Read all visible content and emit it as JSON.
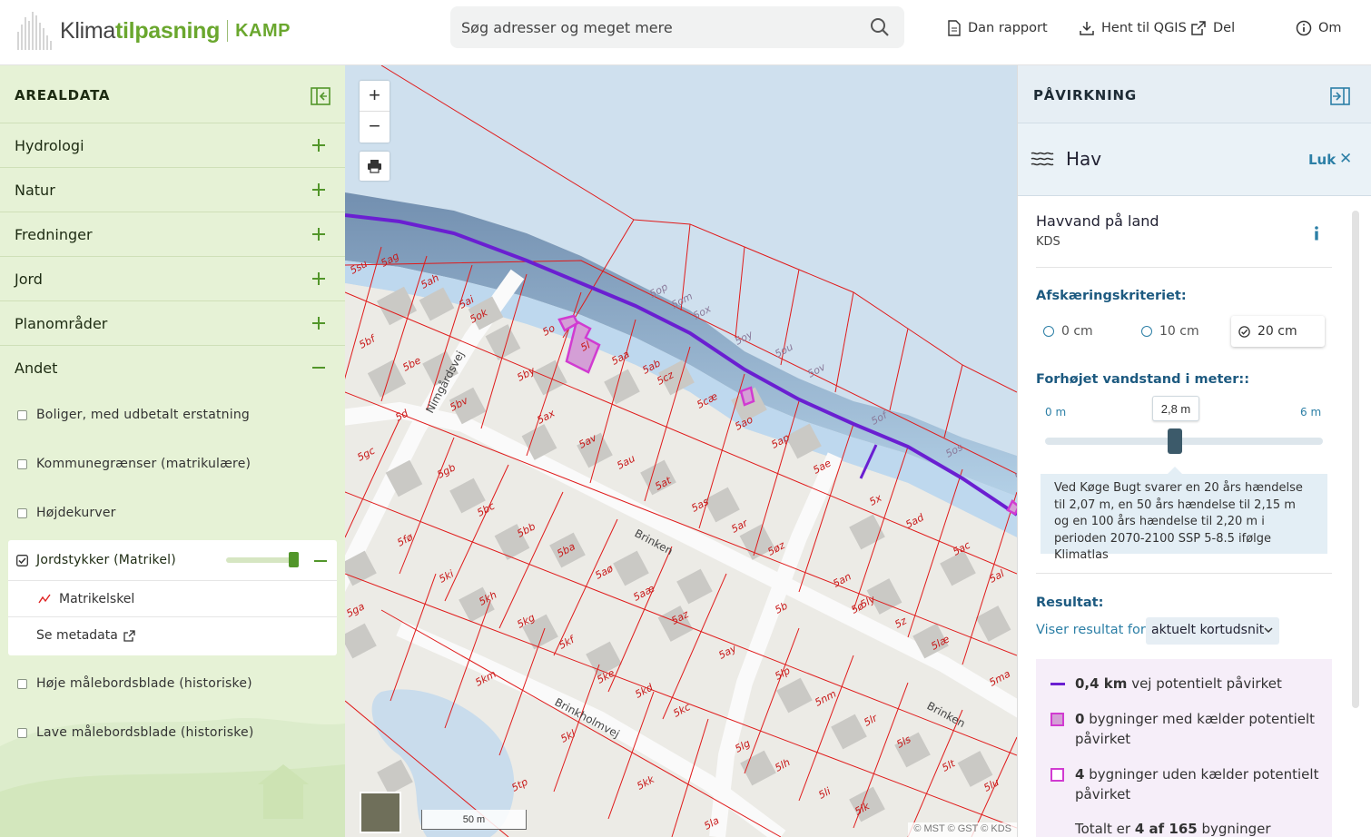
{
  "header": {
    "logo_word1": "Klima",
    "logo_word2": "tilpasning",
    "logo_kamp": "KAMP",
    "search_placeholder": "Søg adresser og meget mere",
    "buttons": [
      {
        "label": "Dan rapport",
        "icon": "document-icon"
      },
      {
        "label": "Hent til QGIS",
        "icon": "download-icon"
      },
      {
        "label": "Del",
        "icon": "share-icon"
      },
      {
        "label": "Om",
        "icon": "info-icon"
      }
    ]
  },
  "left_panel": {
    "title": "AREALDATA",
    "categories": [
      "Hydrologi",
      "Natur",
      "Fredninger",
      "Jord",
      "Planområder",
      "Andet"
    ],
    "layers": [
      "Boliger, med udbetalt erstatning",
      "Kommunegrænser (matrikulære)",
      "Højdekurver"
    ],
    "active_layer": {
      "label": "Jordstykker (Matrikel)",
      "opacity_fraction": 0.9,
      "legend_item": "Matrikelskel",
      "metadata_link": "Se metadata"
    },
    "layers_after": [
      "Høje målebordsblade (historiske)",
      "Lave målebordsblade (historiske)"
    ]
  },
  "map": {
    "zoom_in": "+",
    "zoom_out": "−",
    "scale_label": "50 m",
    "attribution": "© MST  © GST  © KDS",
    "road_labels": [
      "Nimgårdsvej",
      "Brinken",
      "Brinkholmvej",
      "Brinken"
    ],
    "parcel_labels": [
      "5su",
      "5ag",
      "5ah",
      "5ai",
      "5ok",
      "5bf",
      "5be",
      "5o",
      "5l",
      "5by",
      "5aa",
      "5ab",
      "5cz",
      "5bv",
      "5d",
      "5ax",
      "5av",
      "5cæ",
      "5ao",
      "5ap",
      "5ae",
      "5gc",
      "5gb",
      "5bc",
      "5au",
      "5at",
      "5as",
      "5ar",
      "5x",
      "5ad",
      "5ac",
      "5fø",
      "5bb",
      "5ba",
      "5øz",
      "5an",
      "5ly",
      "5z",
      "5al",
      "5ki",
      "5kh",
      "5aø",
      "5aæ",
      "5az",
      "5ay",
      "5b",
      "5ø",
      "5læ",
      "5ga",
      "5kg",
      "5kf",
      "5ke",
      "5kd",
      "5kc",
      "5lp",
      "5nm",
      "5ma",
      "5km",
      "5kl",
      "5lg",
      "5lr",
      "5ls",
      "5lh",
      "5li",
      "5lt",
      "5lu",
      "5tp",
      "5kk",
      "5lk",
      "5la",
      "5op",
      "5om",
      "5ox",
      "5oy",
      "5ou",
      "5ov",
      "5of",
      "5os",
      "5or"
    ]
  },
  "right_panel": {
    "title": "PÅVIRKNING",
    "section": "Hav",
    "close_label": "Luk",
    "layer_title": "Havvand på land",
    "layer_source": "KDS",
    "criteria_label": "Afskæringskriteriet:",
    "criteria_options": [
      "0 cm",
      "10 cm",
      "20 cm"
    ],
    "criteria_selected": "20 cm",
    "water_label": "Forhøjet vandstand i meter::",
    "slider_min": "0 m",
    "slider_max": "6 m",
    "slider_value": "2,8 m",
    "info_text": "Ved Køge Bugt svarer en 20 års hændelse til 2,07 m, en 50 års hændelse til 2,15 m og en 100 års hændelse til 2,20 m i perioden 2070-2100 SSP 5-8.5 ifølge Klimatlas",
    "result_label": "Resultat:",
    "shows_for_label": "Viser resultat for",
    "shows_for_value": "aktuelt kortudsnit",
    "results": [
      {
        "value": "0,4 km",
        "text": "vej potentielt påvirket",
        "color": "#6a1fd1"
      },
      {
        "value": "0",
        "text": "bygninger med kælder potentielt påvirket",
        "color": "#d13bd1"
      },
      {
        "value": "4",
        "text": "bygninger uden kælder potentielt påvirket",
        "color": "#d13bd1"
      }
    ],
    "total_prefix": "Totalt er",
    "total_value": "4 af 165",
    "total_suffix": "bygninger"
  }
}
